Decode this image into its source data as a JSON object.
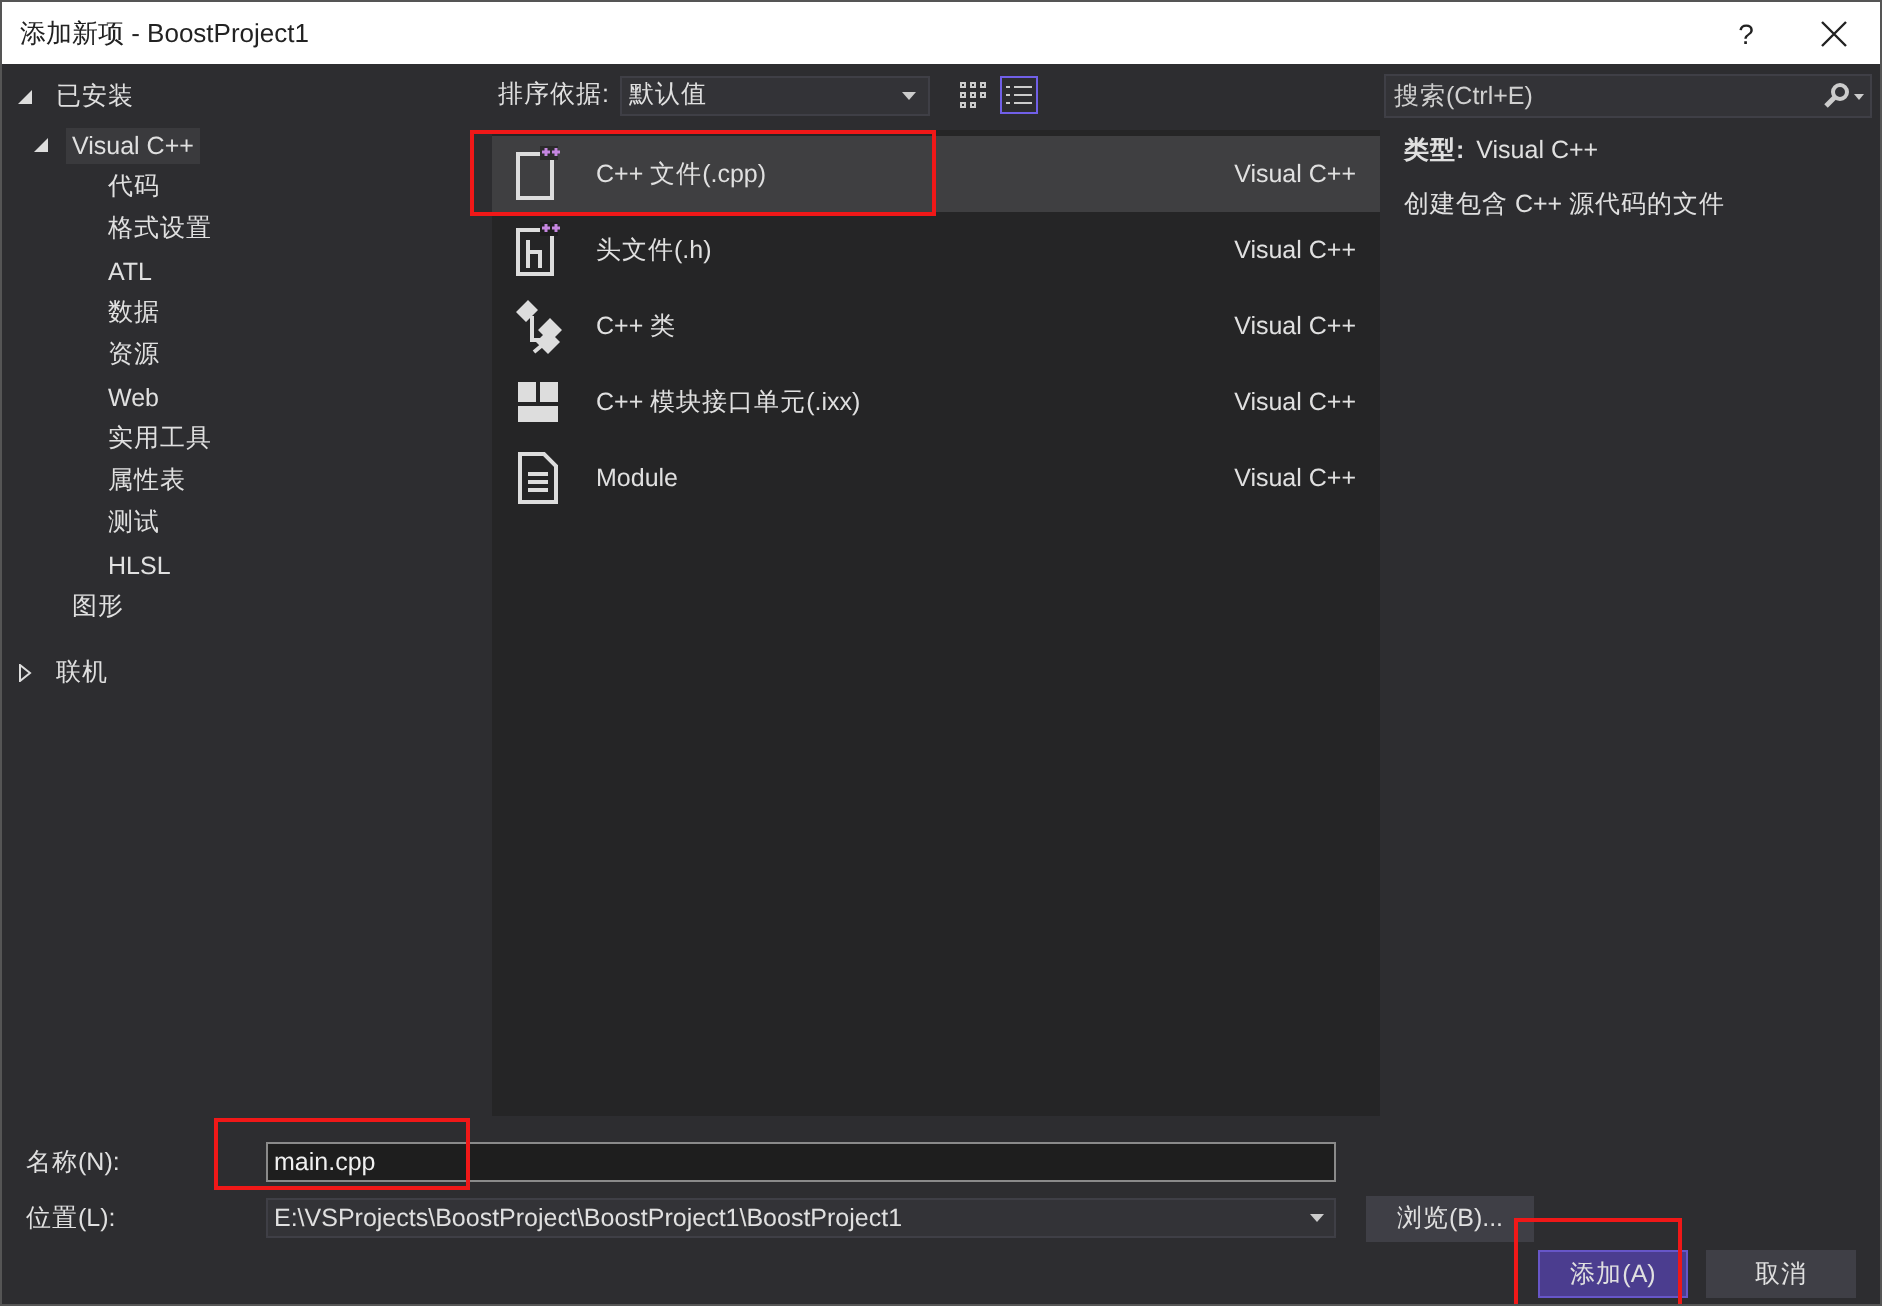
{
  "window": {
    "title": "添加新项 - BoostProject1",
    "help": "?"
  },
  "tree": [
    {
      "label": "已安装",
      "expanded": true,
      "selected": false,
      "children": [
        {
          "label": "Visual C++",
          "expanded": true,
          "selected": true,
          "children": [
            {
              "label": "代码",
              "selected": false
            },
            {
              "label": "格式设置",
              "selected": false
            },
            {
              "label": "ATL",
              "selected": false
            },
            {
              "label": "数据",
              "selected": false
            },
            {
              "label": "资源",
              "selected": false
            },
            {
              "label": "Web",
              "selected": false
            },
            {
              "label": "实用工具",
              "selected": false
            },
            {
              "label": "属性表",
              "selected": false
            },
            {
              "label": "测试",
              "selected": false
            },
            {
              "label": "HLSL",
              "selected": false
            }
          ]
        },
        {
          "label": "图形",
          "selected": false
        }
      ]
    },
    {
      "label": "联机",
      "expanded": false,
      "selected": false
    }
  ],
  "sort": {
    "label": "排序依据:",
    "value": "默认值"
  },
  "view_buttons": [
    {
      "kind": "grid",
      "selected": false
    },
    {
      "kind": "list",
      "selected": true
    }
  ],
  "search": {
    "placeholder": "搜索(Ctrl+E)"
  },
  "templates": [
    {
      "kind": "cpp",
      "name": "C++ 文件(.cpp)",
      "type": "Visual C++",
      "selected": true,
      "highlighted": true
    },
    {
      "kind": "h",
      "name": "头文件(.h)",
      "type": "Visual C++",
      "selected": false,
      "highlighted": false
    },
    {
      "kind": "class",
      "name": "C++ 类",
      "type": "Visual C++",
      "selected": false,
      "highlighted": false
    },
    {
      "kind": "module-unit",
      "name": "C++ 模块接口单元(.ixx)",
      "type": "Visual C++",
      "selected": false,
      "highlighted": false
    },
    {
      "kind": "module",
      "name": "Module",
      "type": "Visual C++",
      "selected": false,
      "highlighted": false
    }
  ],
  "details": {
    "type_label": "类型:",
    "type_value": "Visual C++",
    "description": "创建包含 C++ 源代码的文件"
  },
  "name_field": {
    "label": "名称(N):",
    "value": "main.cpp",
    "highlighted": true
  },
  "location_field": {
    "label": "位置(L):",
    "value": "E:\\VSProjects\\BoostProject\\BoostProject1\\BoostProject1"
  },
  "browse_button": "浏览(B)...",
  "buttons": [
    {
      "label": "添加(A)",
      "primary": true,
      "highlighted": true
    },
    {
      "label": "取消",
      "primary": false,
      "highlighted": false
    }
  ]
}
